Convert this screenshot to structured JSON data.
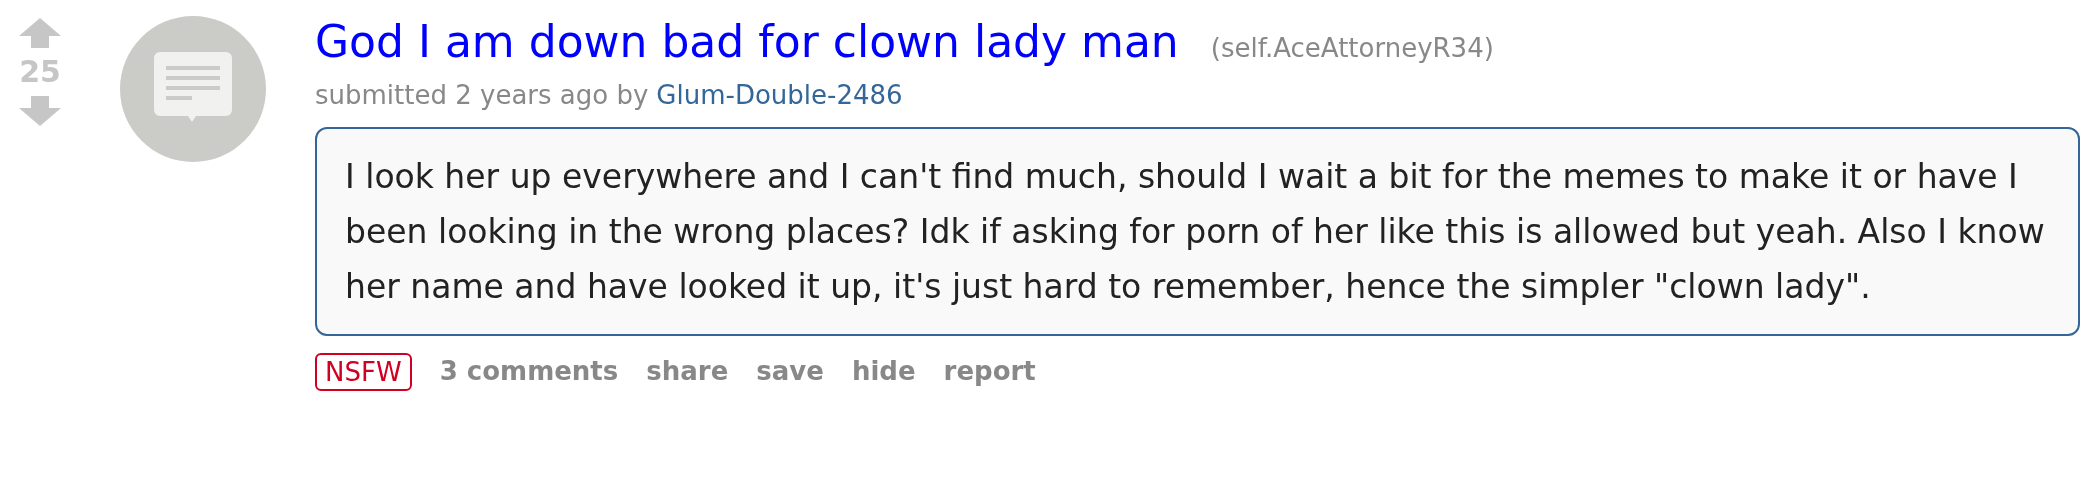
{
  "vote": {
    "score": "25"
  },
  "post": {
    "title": "God I am down bad for clown lady man",
    "domain": "(self.AceAttorneyR34)",
    "tagline": "submitted 2 years ago by",
    "author": "Glum-Double-2486",
    "body": "I look her up everywhere and I can't find much, should I wait a bit for the memes to make it or have I been looking in the wrong places? Idk if asking for porn of her like this is allowed but yeah. Also I know her name and have looked it up, it's just hard to remember, hence the simpler \"clown lady\".",
    "nsfw_tag": "NSFW",
    "actions": [
      "3 comments",
      "share",
      "save",
      "hide",
      "report"
    ]
  }
}
